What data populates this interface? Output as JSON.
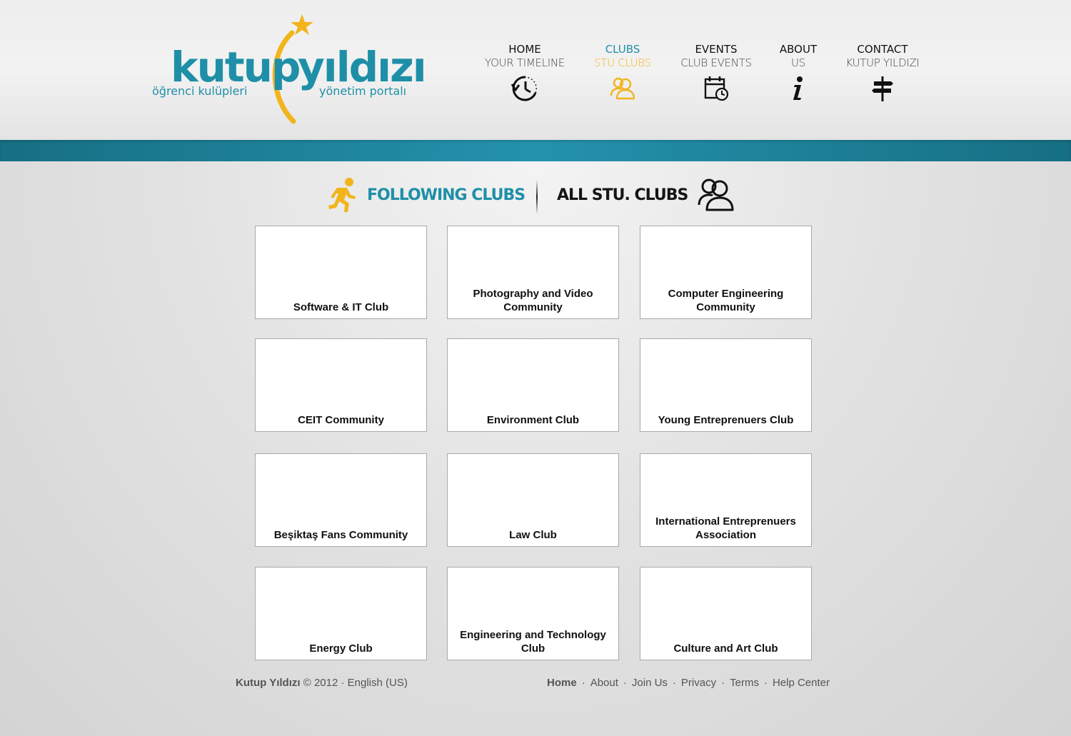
{
  "logo": {
    "word1": "kutup",
    "word2": "yıldızı",
    "sub1": "öğrenci kulüpleri",
    "sub2": "yönetim portalı"
  },
  "nav": [
    {
      "title": "HOME",
      "sub": "YOUR TIMELINE",
      "icon": "clock-icon"
    },
    {
      "title": "CLUBS",
      "sub": "STU CLUBS",
      "icon": "people-icon",
      "active": true
    },
    {
      "title": "EVENTS",
      "sub": "CLUB EVENTS",
      "icon": "calendar-icon"
    },
    {
      "title": "ABOUT",
      "sub": "US",
      "icon": "info-icon"
    },
    {
      "title": "CONTACT",
      "sub": "KUTUP YILDIZI",
      "icon": "signpost-icon"
    }
  ],
  "tabs": {
    "following": "FOLLOWING CLUBS",
    "all": "ALL STU. CLUBS"
  },
  "clubs": [
    "Software & IT Club",
    "Photography and Video Community",
    "Computer Engineering Community",
    "CEIT Community",
    "Environment Club",
    "Young Entreprenuers Club",
    "Beşiktaş Fans Community",
    "Law Club",
    "International Entreprenuers Association",
    "Energy Club",
    "Engineering and Technology Club",
    "Culture and Art Club"
  ],
  "footer": {
    "brand": "Kutup Yıldızı",
    "copyright": "© 2012 · English (US)",
    "links": [
      "Home",
      "About",
      "Join Us",
      "Privacy",
      "Terms",
      "Help Center"
    ]
  },
  "colors": {
    "accent_blue": "#1f8fa8",
    "accent_yellow": "#f2b41c",
    "band": "#2492ad"
  }
}
